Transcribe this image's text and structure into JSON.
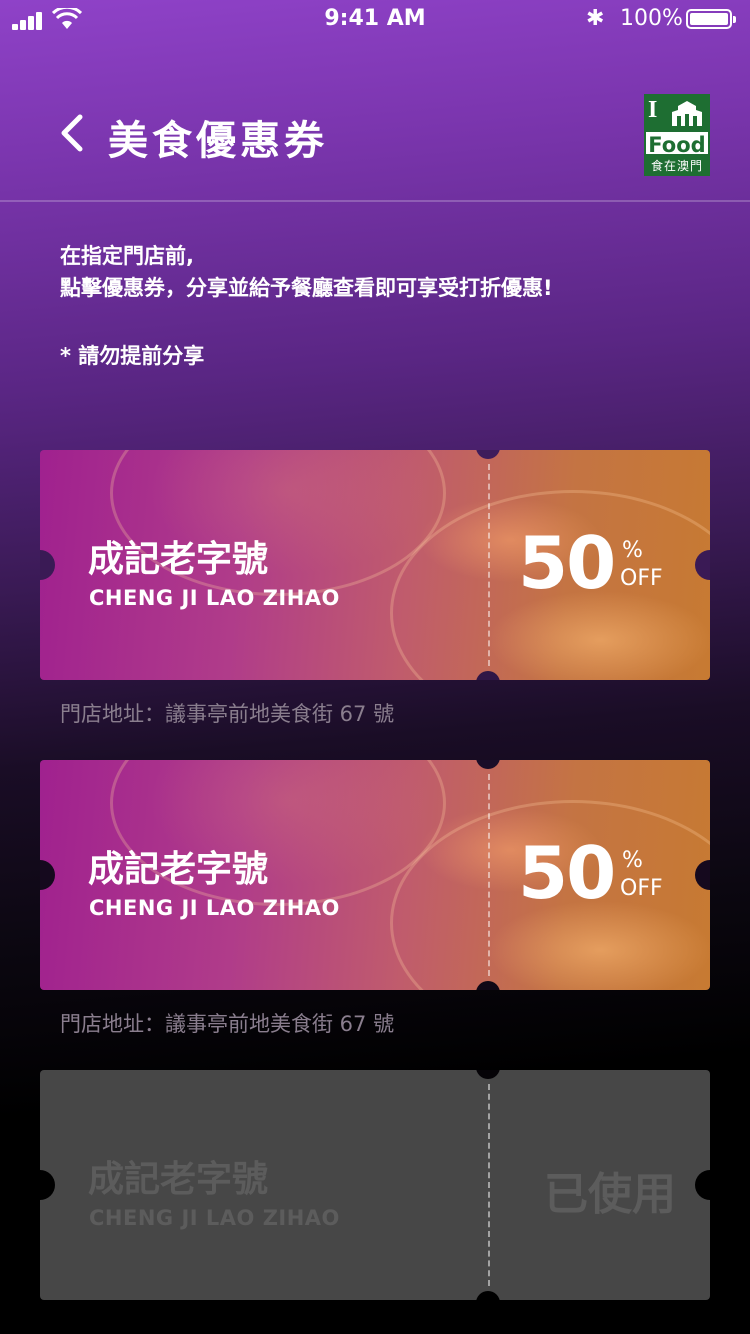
{
  "status_bar": {
    "time": "9:41 AM",
    "battery": "100%",
    "bluetooth": "✱"
  },
  "header": {
    "back_icon": "chevron-left-icon",
    "title": "美食優惠券",
    "logo": {
      "food": "Food",
      "tagline": "食在澳門"
    }
  },
  "intro": {
    "line1": "在指定門店前,",
    "line2": "點擊優惠券，分享並給予餐廳查看即可享受打折優惠!",
    "note": "* 請勿提前分享"
  },
  "coupons": [
    {
      "name": "成記老字號",
      "name_en": "CHENG JI LAO ZIHAO",
      "discount": "50",
      "percent": "%",
      "off": "OFF",
      "address": "門店地址：議事亭前地美食街 67 號",
      "state": "active"
    },
    {
      "name": "成記老字號",
      "name_en": "CHENG JI LAO ZIHAO",
      "discount": "50",
      "percent": "%",
      "off": "OFF",
      "address": "門店地址：議事亭前地美食街 67 號",
      "state": "active"
    },
    {
      "name": "成記老字號",
      "name_en": "CHENG JI LAO ZIHAO",
      "used_label": "已使用",
      "state": "used"
    }
  ],
  "colors": {
    "accent": "#8f42c8",
    "coupon_start": "#a0218f",
    "coupon_end": "#c77a32",
    "used": "#474747"
  }
}
